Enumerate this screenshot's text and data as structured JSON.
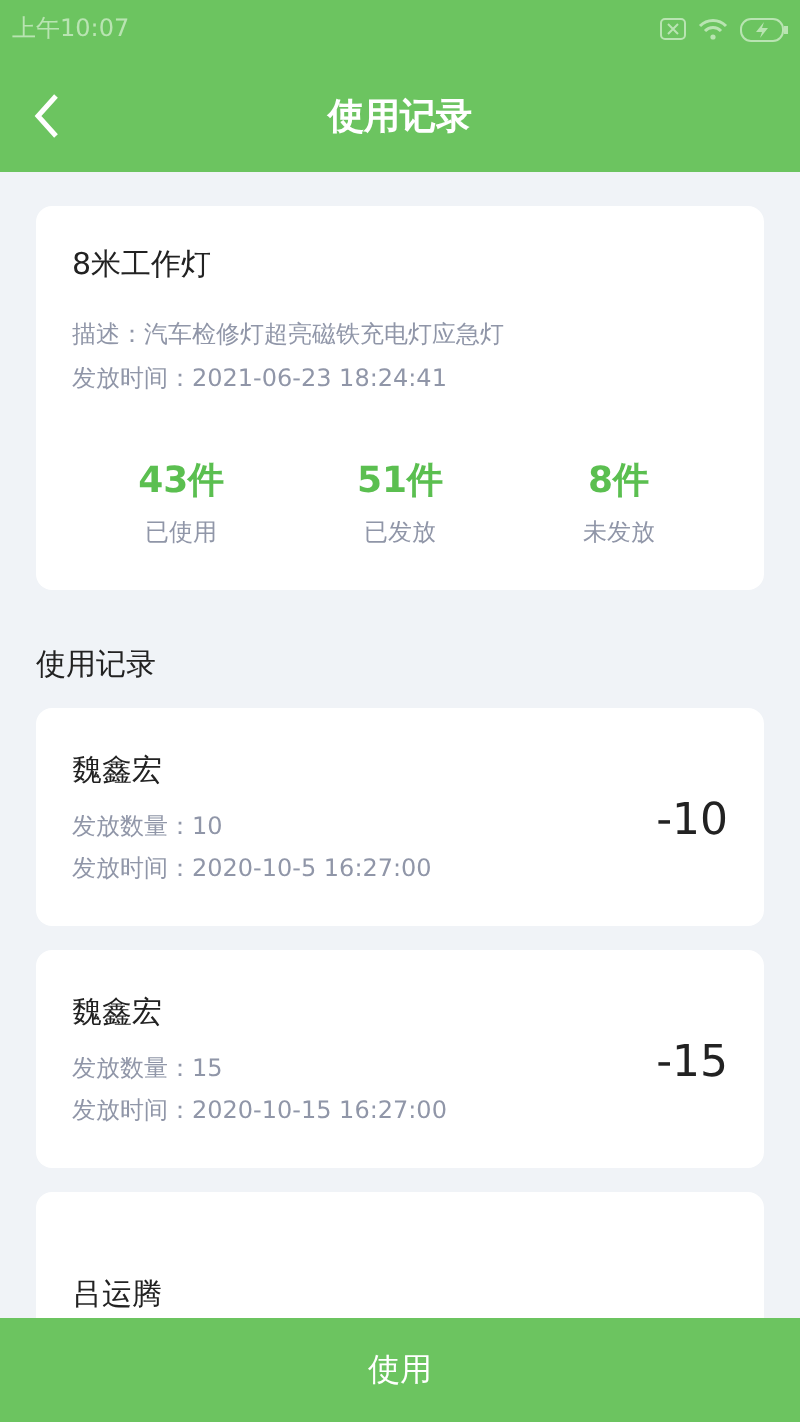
{
  "status_bar": {
    "time": "上午10:07"
  },
  "header": {
    "title": "使用记录"
  },
  "item": {
    "name": "8米工作灯",
    "description": "描述：汽车检修灯超亮磁铁充电灯应急灯",
    "issued_time": "发放时间：2021-06-23 18:24:41",
    "stats": [
      {
        "value": "43件",
        "label": "已使用"
      },
      {
        "value": "51件",
        "label": "已发放"
      },
      {
        "value": "8件",
        "label": "未发放"
      }
    ]
  },
  "section_title": "使用记录",
  "records": [
    {
      "name": "魏鑫宏",
      "quantity": "发放数量：10",
      "time": "发放时间：2020-10-5 16:27:00",
      "change": "-10"
    },
    {
      "name": "魏鑫宏",
      "quantity": "发放数量：15",
      "time": "发放时间：2020-10-15 16:27:00",
      "change": "-15"
    },
    {
      "name": "吕运腾"
    }
  ],
  "bottom_button": "使用"
}
